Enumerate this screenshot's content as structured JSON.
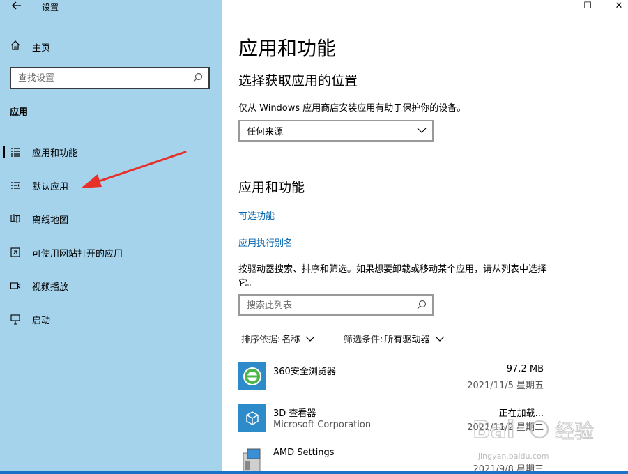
{
  "window": {
    "title": "设置",
    "minimize": "—",
    "maximize": "☐",
    "close": "✕"
  },
  "sidebar": {
    "home_label": "主页",
    "search_placeholder": "查找设置",
    "section_label": "应用",
    "items": [
      {
        "label": "应用和功能",
        "icon": "apps-list-icon",
        "selected": true
      },
      {
        "label": "默认应用",
        "icon": "default-apps-icon",
        "selected": false
      },
      {
        "label": "离线地图",
        "icon": "map-icon",
        "selected": false
      },
      {
        "label": "可使用网站打开的应用",
        "icon": "open-with-icon",
        "selected": false
      },
      {
        "label": "视频播放",
        "icon": "video-icon",
        "selected": false
      },
      {
        "label": "启动",
        "icon": "startup-icon",
        "selected": false
      }
    ]
  },
  "main": {
    "title": "应用和功能",
    "install_section": {
      "heading": "选择获取应用的位置",
      "description": "仅从 Windows 应用商店安装应用有助于保护你的设备。",
      "dropdown_value": "任何来源"
    },
    "apps_section": {
      "heading": "应用和功能",
      "link_optional": "可选功能",
      "link_alias": "应用执行别名",
      "description": "按驱动器搜索、排序和筛选。如果想要卸载或移动某个应用，请从列表中选择它。",
      "search_placeholder": "搜索此列表",
      "sort_label": "排序依据:",
      "sort_value": "名称",
      "filter_label": "筛选条件:",
      "filter_value": "所有驱动器"
    },
    "apps": [
      {
        "name": "360安全浏览器",
        "publisher": "",
        "size": "97.2 MB",
        "date": "2021/11/5 星期五",
        "tile_color": "#2e8bc9"
      },
      {
        "name": "3D 查看器",
        "publisher": "Microsoft Corporation",
        "size": "正在加载...",
        "date": "2021/11/2 星期二",
        "tile_color": "#2e8bc9"
      },
      {
        "name": "AMD Settings",
        "publisher": "",
        "size": "",
        "date": "2021/9/8 星期三",
        "tile_color": "#2e8bc9"
      }
    ]
  },
  "watermark": {
    "text": "jingyan.baidu.com"
  },
  "colors": {
    "sidebar_bg": "#a5d3ec",
    "link": "#0063b1",
    "arrow": "#e8302a",
    "accent": "#1a73c6"
  }
}
